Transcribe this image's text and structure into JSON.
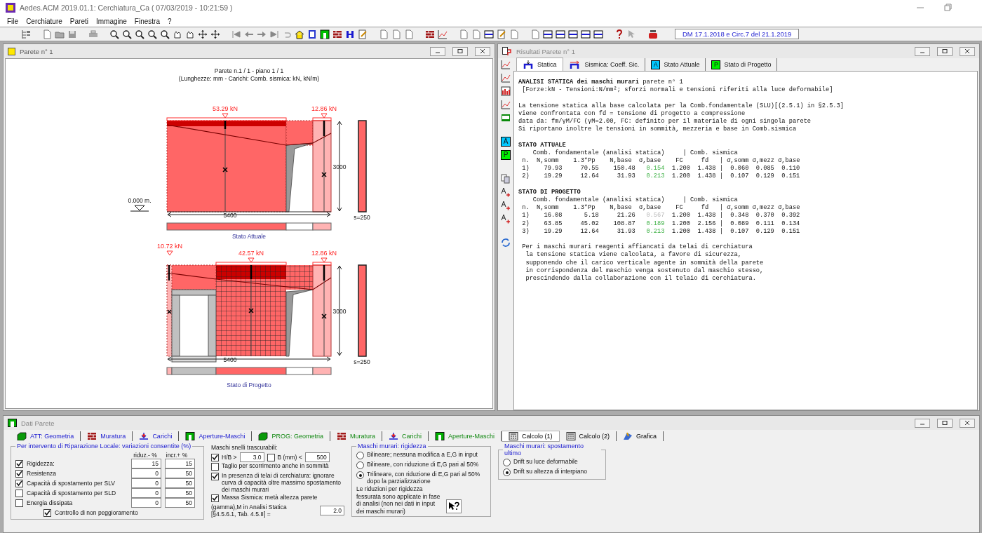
{
  "app": {
    "title": "Aedes.ACM 2019.01.1: Cerchiatura_Ca  ( 07/03/2019 - 10:21:59 )"
  },
  "menu": [
    {
      "label": "File"
    },
    {
      "label": "Cerchiature"
    },
    {
      "label": "Pareti"
    },
    {
      "label": "Immagine"
    },
    {
      "label": "Finestra"
    },
    {
      "label": "?"
    }
  ],
  "toolbar": {
    "norm_label": "DM 17.1.2018 e Circ.7 del 21.1.2019"
  },
  "wall_window": {
    "title": "Parete n° 1",
    "heading": "Parete n.1 / 1 - piano 1 / 1",
    "subheading": "(Lunghezze: mm - Carichi: Comb. sismica: kN, kN/m)",
    "diagrams": [
      {
        "kind": "attuale",
        "loads": [
          "53.29 kN",
          "12.86 kN"
        ],
        "height_dim": "3000",
        "length_dim": "5400",
        "section_label": "s=250",
        "level_label": "0.000 m.",
        "caption": "Stato Attuale"
      },
      {
        "kind": "progetto",
        "loads": [
          "10.72 kN",
          "42.57 kN",
          "12.86 kN"
        ],
        "height_dim": "3000",
        "length_dim": "5400",
        "section_label": "s=250",
        "caption": "Stato di Progetto"
      }
    ]
  },
  "results_window": {
    "title": "Risultati Parete n° 1",
    "side_letters": [
      "A",
      "P"
    ],
    "tabs": [
      {
        "label": "Statica",
        "kind": "static",
        "selected": true
      },
      {
        "label": "Sismica: Coeff. Sic.",
        "kind": "seismic",
        "selected": false
      },
      {
        "label": "Stato Attuale",
        "kind": "letter",
        "letter": "A",
        "selected": false
      },
      {
        "label": "Stato di Progetto",
        "kind": "letter",
        "letter": "P",
        "selected": false
      }
    ],
    "report": [
      {
        "kind": "text",
        "lines": [
          "**ANALISI STATICA dei maschi murari** parete n° 1",
          " [Forze:kN - Tensioni:N/mm²; sforzi normali e tensioni riferiti alla luce deformabile]"
        ]
      },
      {
        "kind": "text",
        "lines": [
          "La tensione statica alla base calcolata per la Comb.fondamentale (SLU)[(2.5.1) in §2.5.3]",
          "viene confrontata con fd = tensione di progetto a compressione",
          "data da: fm/γM/FC (γM=2.00, FC: definito per il materiale di ogni singola parete",
          "Si riportano inoltre le tensioni in sommità, mezzeria e base in Comb.sismica"
        ]
      },
      {
        "kind": "table",
        "heading": "STATO ATTUALE",
        "header_lines": [
          "    Comb. fondamentale (analisi statica)     | Comb. sismica",
          " n.  N,somm    1.3*Pp    N,base  σ,base    FC     fd   | σ,somm σ,mezz σ,base"
        ],
        "rows": [
          {
            "cells": [
              "1)",
              "79.93",
              "70.55",
              "150.48",
              "0.154",
              "1.200",
              "1.438",
              "|",
              "0.060",
              "0.085",
              "0.110"
            ],
            "verified": true
          },
          {
            "cells": [
              "2)",
              "19.29",
              "12.64",
              "31.93",
              "0.213",
              "1.200",
              "1.438",
              "|",
              "0.107",
              "0.129",
              "0.151"
            ],
            "verified": true
          }
        ]
      },
      {
        "kind": "table",
        "heading": "STATO DI PROGETTO",
        "header_lines": [
          "    Comb. fondamentale (analisi statica)     | Comb. sismica",
          " n.  N,somm    1.3*Pp    N,base  σ,base    FC     fd   | σ,somm σ,mezz σ,base"
        ],
        "rows": [
          {
            "cells": [
              "1)",
              "16.08",
              "5.18",
              "21.26",
              "0.567",
              "1.200",
              "1.438",
              "|",
              "0.348",
              "0.370",
              "0.392"
            ],
            "verified": false
          },
          {
            "cells": [
              "2)",
              "63.85",
              "45.02",
              "108.87",
              "0.189",
              "1.200",
              "2.156",
              "|",
              "0.089",
              "0.111",
              "0.134"
            ],
            "verified": true
          },
          {
            "cells": [
              "3)",
              "19.29",
              "12.64",
              "31.93",
              "0.213",
              "1.200",
              "1.438",
              "|",
              "0.107",
              "0.129",
              "0.151"
            ],
            "verified": true
          }
        ]
      },
      {
        "kind": "text",
        "lines": [
          " Per i maschi murari reagenti affiancati da telai di cerchiatura",
          "  la tensione statica viene calcolata, a favore di sicurezza,",
          "  supponendo che il carico verticale agente in sommità della parete",
          "  in corrispondenza del maschio venga sostenuto dal maschio stesso,",
          "  prescindendo dalla collaborazione con il telaio di cerchiatura."
        ]
      }
    ]
  },
  "data_window": {
    "title": "Dati Parete",
    "tabs": [
      {
        "label": "ATT: Geometria",
        "kind": "att",
        "selected": false
      },
      {
        "label": "Muratura",
        "kind": "att",
        "selected": false
      },
      {
        "label": "Carichi",
        "kind": "att",
        "selected": false
      },
      {
        "label": "Aperture-Maschi",
        "kind": "att",
        "selected": false
      },
      {
        "label": "PROG: Geometria",
        "kind": "prog",
        "selected": false
      },
      {
        "label": "Muratura",
        "kind": "prog",
        "selected": false
      },
      {
        "label": "Carichi",
        "kind": "prog",
        "selected": false
      },
      {
        "label": "Aperture-Maschi",
        "kind": "prog",
        "selected": false
      },
      {
        "label": "Calcolo (1)",
        "kind": "calc",
        "selected": true
      },
      {
        "label": "Calcolo (2)",
        "kind": "calc",
        "selected": false
      },
      {
        "label": "Grafica",
        "kind": "calc",
        "selected": false
      }
    ],
    "repair_group": {
      "title": "Per intervento di Riparazione Locale: variazioni consentite (%)",
      "columns": [
        "riduz.- %",
        "incr.+ %"
      ],
      "rows": [
        {
          "label": "Rigidezza:",
          "checked": true,
          "values": [
            "15",
            "15"
          ]
        },
        {
          "label": "Resistenza",
          "checked": true,
          "values": [
            "0",
            "50"
          ]
        },
        {
          "label": "Capacità di spostamento per SLV",
          "checked": true,
          "values": [
            "0",
            "50"
          ]
        },
        {
          "label": "Capacità di spostamento per SLD",
          "checked": false,
          "values": [
            "0",
            "50"
          ]
        },
        {
          "label": "Energia dissipata",
          "checked": false,
          "values": [
            "0",
            "50"
          ]
        }
      ],
      "footer": {
        "label": "Controllo di non peggioramento",
        "checked": true
      }
    },
    "slender_group": {
      "title": "Maschi snelli trascurabili:",
      "hb": {
        "label": "H/B >",
        "checked": true,
        "value": "3.0"
      },
      "b": {
        "label": "B (mm) <",
        "checked": false,
        "value": "500"
      },
      "options": [
        {
          "label": "Taglio per scorrimento anche in sommità",
          "checked": false
        },
        {
          "label": "In presenza di telai di cerchiatura: ignorare curva di capacità oltre massimo spostamento dei maschi murari",
          "checked": true
        },
        {
          "label": "Massa Sismica: metà altezza parete",
          "checked": true
        }
      ],
      "gamma": {
        "label": "(gamma),M in Analisi Statica [§4.5.6.1, Tab. 4.5.II] =",
        "value": "2.0"
      }
    },
    "stiffness_group": {
      "title": "Maschi murari: rigidezza",
      "options": [
        {
          "label": "Bilineare; nessuna modifica a E,G in input",
          "selected": false
        },
        {
          "label": "Bilineare, con riduzione di E,G pari al 50%",
          "selected": false
        },
        {
          "label": "Trilineare, con riduzione di E,G pari al 50% dopo la parzializzazione",
          "selected": true
        }
      ],
      "note": "Le riduzioni per rigidezza fessurata sono applicate in fase di analisi (non nei dati in input dei maschi murari)"
    },
    "drift_group": {
      "title": "Maschi murari: spostamento ultimo",
      "options": [
        {
          "label": "Drift su luce deformabile",
          "selected": false
        },
        {
          "label": "Drift su altezza di interpiano",
          "selected": true
        }
      ]
    }
  }
}
